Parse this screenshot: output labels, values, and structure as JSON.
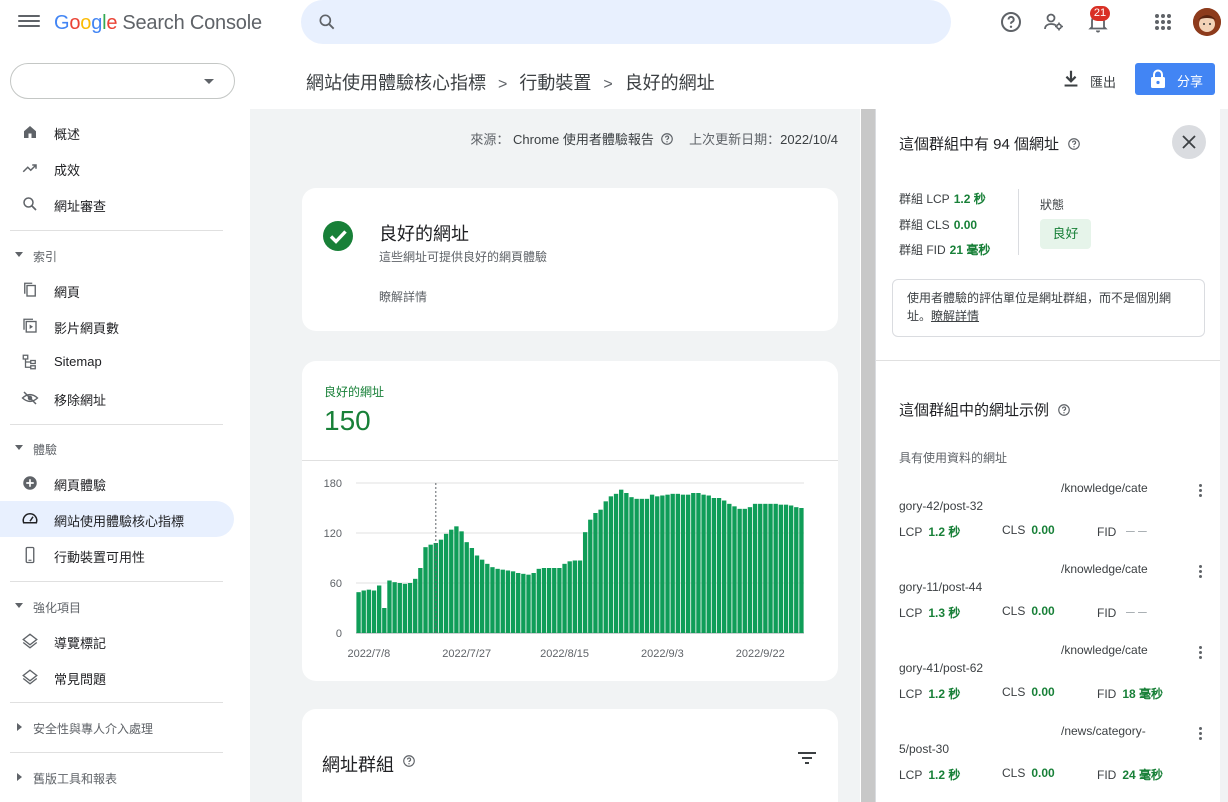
{
  "app": {
    "logo_letters": [
      "G",
      "o",
      "o",
      "g",
      "l",
      "e"
    ],
    "logo_rest": "Search Console",
    "notification_count": "21",
    "colors": {
      "brand_blue": "#4285f4",
      "good_green": "#188038",
      "chip_bg": "#e6f4ea"
    }
  },
  "search": {
    "placeholder": ""
  },
  "property": {
    "value": ""
  },
  "sidebar": {
    "items": [
      {
        "label": "概述",
        "icon": "home-icon"
      },
      {
        "label": "成效",
        "icon": "trending-up-icon"
      },
      {
        "label": "網址審查",
        "icon": "search-icon"
      }
    ],
    "section_index": {
      "label": "索引",
      "items": [
        {
          "label": "網頁",
          "icon": "pages-icon"
        },
        {
          "label": "影片網頁數",
          "icon": "video-icon"
        },
        {
          "label": "Sitemap",
          "icon": "sitemap-icon"
        },
        {
          "label": "移除網址",
          "icon": "eye-off-icon"
        }
      ]
    },
    "section_experience": {
      "label": "體驗",
      "items": [
        {
          "label": "網頁體驗",
          "icon": "plus-circle-icon"
        },
        {
          "label": "網站使用體驗核心指標",
          "icon": "gauge-icon",
          "active": true
        },
        {
          "label": "行動裝置可用性",
          "icon": "phone-icon"
        }
      ]
    },
    "section_enhancements": {
      "label": "強化項目",
      "items": [
        {
          "label": "導覽標記",
          "icon": "layers-icon"
        },
        {
          "label": "常見問題",
          "icon": "layers-icon"
        }
      ]
    },
    "section_security": {
      "label": "安全性與專人介入處理"
    },
    "section_legacy": {
      "label": "舊版工具和報表"
    }
  },
  "header": {
    "breadcrumb": [
      "網站使用體驗核心指標",
      "行動裝置",
      "良好的網址"
    ],
    "export_label": "匯出",
    "share_label": "分享"
  },
  "main": {
    "source_label": "來源：",
    "source_value": "Chrome 使用者體驗報告",
    "updated_label": "上次更新日期：",
    "updated_value": "2022/10/4",
    "status_card": {
      "title": "良好的網址",
      "subtitle": "這些網址可提供良好的網頁體驗",
      "learn_more": "瞭解詳情"
    },
    "metric_card": {
      "label": "良好的網址",
      "value": "150"
    },
    "groups_card": {
      "title": "網址群組"
    }
  },
  "chart_data": {
    "type": "bar",
    "series": [
      {
        "name": "良好的網址",
        "color": "#0f9d58"
      }
    ],
    "y_ticks": [
      0,
      60,
      120,
      180
    ],
    "ylim": [
      0,
      180
    ],
    "x_tick_labels": [
      "2022/7/8",
      "2022/7/27",
      "2022/8/15",
      "2022/9/3",
      "2022/9/22"
    ],
    "x_tick_index": [
      2,
      21,
      40,
      59,
      78
    ],
    "highlight_index": 15,
    "values": [
      49,
      51,
      52,
      51,
      57,
      30,
      63,
      61,
      60,
      59,
      60,
      65,
      78,
      103,
      106,
      108,
      112,
      119,
      124,
      128,
      122,
      109,
      102,
      93,
      88,
      83,
      79,
      77,
      76,
      75,
      74,
      72,
      71,
      70,
      72,
      77,
      78,
      78,
      78,
      78,
      83,
      86,
      87,
      87,
      121,
      136,
      144,
      148,
      158,
      164,
      167,
      172,
      168,
      163,
      161,
      161,
      161,
      166,
      164,
      165,
      166,
      167,
      167,
      166,
      166,
      168,
      168,
      166,
      165,
      162,
      162,
      159,
      155,
      152,
      149,
      149,
      151,
      155,
      155,
      155,
      155,
      155,
      154,
      154,
      153,
      151,
      150
    ]
  },
  "panel": {
    "title": "這個群組中有 94 個網址",
    "stats": [
      {
        "label": "群組 LCP",
        "value": "1.2 秒"
      },
      {
        "label": "群組 CLS",
        "value": "0.00"
      },
      {
        "label": "群組 FID",
        "value": "21 毫秒"
      }
    ],
    "status_label": "狀態",
    "status_value": "良好",
    "note_text": "使用者體驗的評估單位是網址群組，而不是個別網址。",
    "note_link": "瞭解詳情",
    "examples_title": "這個群組中的網址示例",
    "examples_subtitle": "具有使用資料的網址",
    "urls": [
      {
        "line1": "/knowledge/cate",
        "line2": "gory-42/post-32",
        "lcp": "1.2 秒",
        "cls": "0.00",
        "fid": "－－",
        "fid_na": true
      },
      {
        "line1": "/knowledge/cate",
        "line2": "gory-11/post-44",
        "lcp": "1.3 秒",
        "cls": "0.00",
        "fid": "－－",
        "fid_na": true
      },
      {
        "line1": "/knowledge/cate",
        "line2": "gory-41/post-62",
        "lcp": "1.2 秒",
        "cls": "0.00",
        "fid": "18 毫秒",
        "fid_na": false
      },
      {
        "line1": "/news/category-",
        "line2": "5/post-30",
        "lcp": "1.2 秒",
        "cls": "0.00",
        "fid": "24 毫秒",
        "fid_na": false
      }
    ],
    "metric_labels": {
      "lcp": "LCP",
      "cls": "CLS",
      "fid": "FID"
    }
  }
}
